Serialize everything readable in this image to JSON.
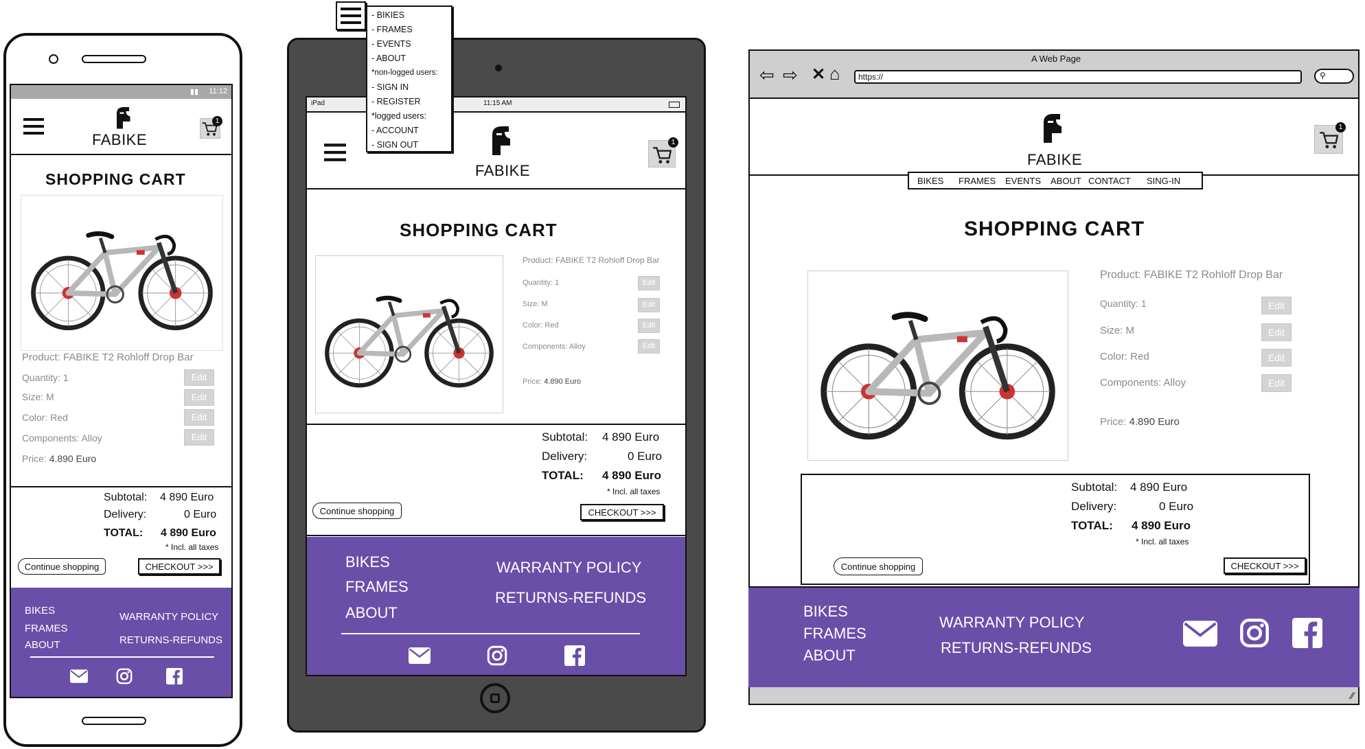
{
  "brand": {
    "name": "FABIKE"
  },
  "colors": {
    "footer": "#6a4fa8",
    "edit_button": "#d4d4d4",
    "device_frame": "#4a4a4a"
  },
  "phone": {
    "status_time": "11:12",
    "cart_count": "1",
    "title": "SHOPPING CART",
    "product": "Product: FABIKE T2 Rohloff Drop Bar",
    "quantity": "Quantity: 1",
    "size": "Size: M",
    "color": "Color: Red",
    "components": "Components: Alloy",
    "price_label": "Price:",
    "price_value": "4.890 Euro",
    "edit": "Edit",
    "subtotal_label": "Subtotal:",
    "subtotal_value": "4 890 Euro",
    "delivery_label": "Delivery:",
    "delivery_value": "0 Euro",
    "total_label": "TOTAL:",
    "total_value": "4 890 Euro",
    "taxes": "* Incl. all taxes",
    "continue": "Continue shopping",
    "checkout": "CHECKOUT >>>",
    "footer_left": [
      "BIKES",
      "FRAMES",
      "ABOUT"
    ],
    "footer_right": [
      "WARRANTY POLICY",
      "RETURNS-REFUNDS"
    ]
  },
  "tablet": {
    "status_device": "iPad",
    "status_time": "11:15 AM",
    "cart_count": "1",
    "title": "SHOPPING CART",
    "product": "Product: FABIKE T2 Rohloff Drop Bar",
    "quantity": "Quantity: 1",
    "size": "Size: M",
    "color": "Color: Red",
    "components": "Components: Alloy",
    "price_label": "Price:",
    "price_value": "4.890 Euro",
    "edit": "Edit",
    "subtotal_label": "Subtotal:",
    "subtotal_value": "4 890 Euro",
    "delivery_label": "Delivery:",
    "delivery_value": "0 Euro",
    "total_label": "TOTAL:",
    "total_value": "4 890 Euro",
    "taxes": "* Incl. all taxes",
    "continue": "Continue shopping",
    "checkout": "CHECKOUT >>>",
    "footer_left": [
      "BIKES",
      "FRAMES",
      "ABOUT"
    ],
    "footer_right": [
      "WARRANTY POLICY",
      "RETURNS-REFUNDS"
    ],
    "menu": [
      "- BIKIES",
      "- FRAMES",
      "- EVENTS",
      "- ABOUT",
      "*non-logged users:",
      "- SIGN IN",
      "- REGISTER",
      "*logged users:",
      "- ACCOUNT",
      "- SIGN OUT"
    ]
  },
  "desktop": {
    "window_title": "A Web Page",
    "url": "https://",
    "cart_count": "1",
    "nav": [
      "BIKES",
      "FRAMES",
      "EVENTS",
      "ABOUT",
      "CONTACT",
      "SING-IN"
    ],
    "title": "SHOPPING CART",
    "product": "Product: FABIKE T2 Rohloff Drop Bar",
    "quantity": "Quantity: 1",
    "size": "Size: M",
    "color": "Color: Red",
    "components": "Components: Alloy",
    "price_label": "Price:",
    "price_value": "4.890 Euro",
    "edit": "Edit",
    "subtotal_label": "Subtotal:",
    "subtotal_value": "4 890 Euro",
    "delivery_label": "Delivery:",
    "delivery_value": "0 Euro",
    "total_label": "TOTAL:",
    "total_value": "4 890 Euro",
    "taxes": "* Incl. all taxes",
    "continue": "Continue shopping",
    "checkout": "CHECKOUT >>>",
    "footer_left": [
      "BIKES",
      "FRAMES",
      "ABOUT"
    ],
    "footer_right": [
      "WARRANTY POLICY",
      "RETURNS-REFUNDS"
    ]
  }
}
